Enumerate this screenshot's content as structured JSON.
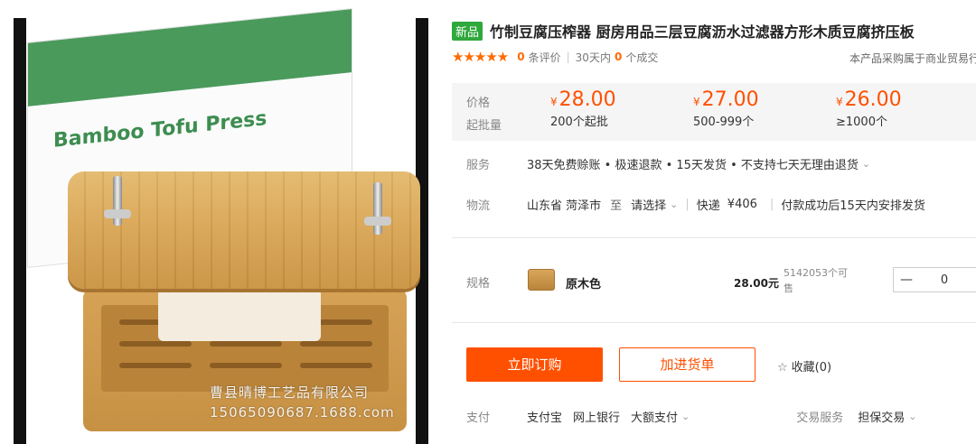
{
  "product_image": {
    "box_text": "Bamboo Tofu Press",
    "watermark_company": "曹县晴博工艺品有限公司",
    "watermark_phone": "15065090687.1688.com"
  },
  "header": {
    "badge": "新品",
    "title": "竹制豆腐压榨器 厨房用品三层豆腐沥水过滤器方形木质豆腐挤压板"
  },
  "rating": {
    "stars": "★★★★★",
    "reviews_count": "0",
    "reviews_label": "条评价",
    "days_label": "30天内",
    "deals_count": "0",
    "deals_label": "个成交",
    "trade_note": "本产品采购属于商业贸易行为"
  },
  "price": {
    "label_price": "价格",
    "label_moq": "起批量",
    "currency": "¥",
    "tiers": [
      {
        "price": "28.00",
        "qty": "200个起批"
      },
      {
        "price": "27.00",
        "qty": "500-999个"
      },
      {
        "price": "26.00",
        "qty": "≥1000个"
      }
    ]
  },
  "service": {
    "label": "服务",
    "text": "38天免费赊账 • 极速退款 • 15天发货 • 不支持七天无理由退货"
  },
  "logistics": {
    "label": "物流",
    "origin": "山东省 菏泽市",
    "to": "至",
    "dest_placeholder": "请选择",
    "express": "快递",
    "fee": "¥406",
    "ship_time": "付款成功后15天内安排发货"
  },
  "spec": {
    "label": "规格",
    "name": "原木色",
    "price": "28.00元",
    "stock": "5142053个可售",
    "qty_minus": "—",
    "qty_value": "0"
  },
  "actions": {
    "buy_label": "立即订购",
    "cart_label": "加进货单",
    "fav_label": "收藏(0)"
  },
  "payment": {
    "label": "支付",
    "methods": [
      "支付宝",
      "网上银行",
      "大额支付"
    ],
    "trade_service_label": "交易服务",
    "trade_service_value": "担保交易"
  },
  "colors": {
    "accent": "#ff5000",
    "badge_green": "#2fa83c",
    "price_bg": "#f5f5f5"
  }
}
